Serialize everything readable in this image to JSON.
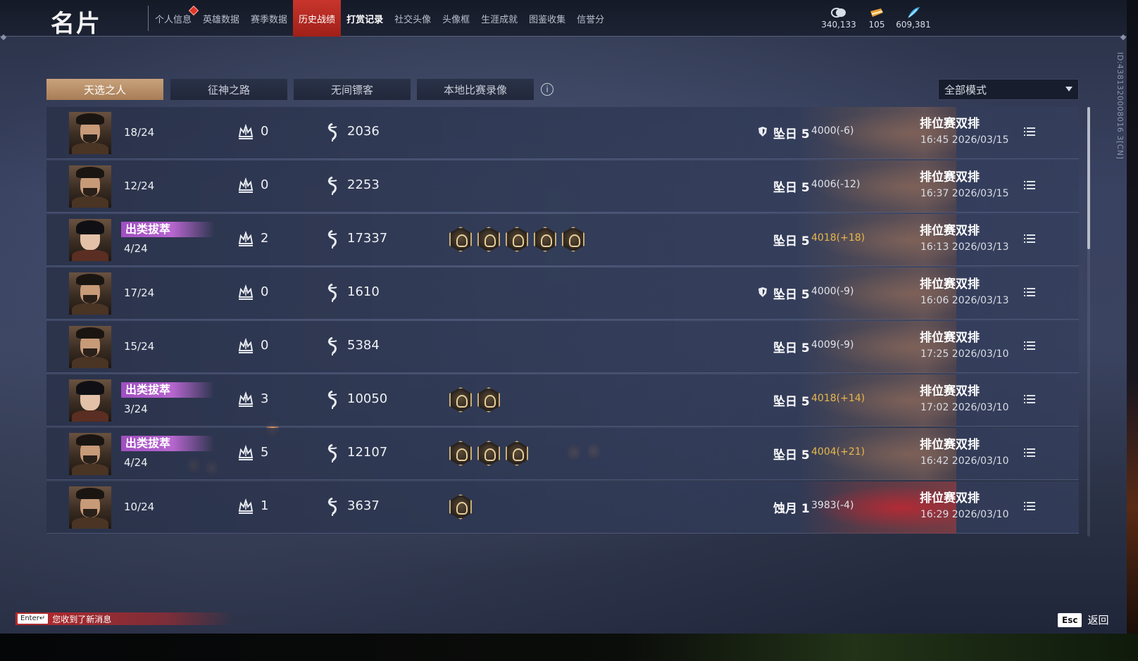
{
  "header": {
    "title": "名片",
    "tabs": [
      {
        "label": "个人信息",
        "dot": true
      },
      {
        "label": "英雄数据"
      },
      {
        "label": "赛季数据"
      },
      {
        "label": "历史战绩",
        "active": true
      },
      {
        "label": "打赏记录",
        "bold": true
      },
      {
        "label": "社交头像"
      },
      {
        "label": "头像框"
      },
      {
        "label": "生涯成就"
      },
      {
        "label": "图鉴收集"
      },
      {
        "label": "信誉分"
      }
    ],
    "currencies": [
      {
        "icon": "coin-stack-icon",
        "value": "340,133"
      },
      {
        "icon": "ticket-icon",
        "value": "105"
      },
      {
        "icon": "feather-icon",
        "value": "609,381"
      }
    ]
  },
  "subtabs": [
    "天选之人",
    "征神之路",
    "无间镖客",
    "本地比赛录像"
  ],
  "mode_select": {
    "value": "全部模式"
  },
  "rows": [
    {
      "avatar": "warrior",
      "badge": "",
      "ratio": "18/24",
      "kills": "0",
      "gold": "2036",
      "medals": [],
      "shield": true,
      "rank": "坠日 5",
      "score": "4000(-6)",
      "gain": false,
      "art": "dragon",
      "mode": "排位赛双排",
      "time": "16:45  2026/03/15"
    },
    {
      "avatar": "warrior",
      "badge": "",
      "ratio": "12/24",
      "kills": "0",
      "gold": "2253",
      "medals": [],
      "shield": false,
      "rank": "坠日 5",
      "score": "4006(-12)",
      "gain": false,
      "art": "dragon",
      "mode": "排位赛双排",
      "time": "16:37  2026/03/15"
    },
    {
      "avatar": "scholar",
      "badge": "出类拔萃",
      "ratio": "4/24",
      "kills": "2",
      "gold": "17337",
      "medals": [
        "medal-1",
        "medal-2",
        "medal-3",
        "medal-4",
        "medal-5"
      ],
      "shield": false,
      "rank": "坠日 5",
      "score": "4018(+18)",
      "gain": true,
      "art": "dragon",
      "mode": "排位赛双排",
      "time": "16:13  2026/03/13"
    },
    {
      "avatar": "warrior",
      "badge": "",
      "ratio": "17/24",
      "kills": "0",
      "gold": "1610",
      "medals": [],
      "shield": true,
      "rank": "坠日 5",
      "score": "4000(-9)",
      "gain": false,
      "art": "dragon",
      "mode": "排位赛双排",
      "time": "16:06  2026/03/13"
    },
    {
      "avatar": "warrior",
      "badge": "",
      "ratio": "15/24",
      "kills": "0",
      "gold": "5384",
      "medals": [],
      "shield": false,
      "rank": "坠日 5",
      "score": "4009(-9)",
      "gain": false,
      "art": "dragon",
      "mode": "排位赛双排",
      "time": "17:25  2026/03/10"
    },
    {
      "avatar": "scholar",
      "badge": "出类拔萃",
      "ratio": "3/24",
      "kills": "3",
      "gold": "10050",
      "medals": [
        "medal-1",
        "medal-2"
      ],
      "shield": false,
      "rank": "坠日 5",
      "score": "4018(+14)",
      "gain": true,
      "art": "dragon",
      "mode": "排位赛双排",
      "time": "17:02  2026/03/10"
    },
    {
      "avatar": "warrior",
      "badge": "出类拔萃",
      "ratio": "4/24",
      "kills": "5",
      "gold": "12107",
      "medals": [
        "medal-1",
        "medal-2",
        "medal-3"
      ],
      "shield": false,
      "rank": "坠日 5",
      "score": "4004(+21)",
      "gain": true,
      "art": "dragon",
      "mode": "排位赛双排",
      "time": "16:42  2026/03/10"
    },
    {
      "avatar": "warrior",
      "badge": "",
      "ratio": "10/24",
      "kills": "1",
      "gold": "3637",
      "medals": [
        "medal-1"
      ],
      "shield": false,
      "rank": "蚀月 1",
      "score": "3983(-4)",
      "gain": false,
      "art": "red-moon",
      "mode": "排位赛双排",
      "time": "16:29  2026/03/10"
    }
  ],
  "side_id": "ID:4381320008016 3[CN]",
  "footer": {
    "enter_key": "Enter↵",
    "notification": "您收到了新消息",
    "esc_key": "Esc",
    "back_label": "返回"
  },
  "colors": {
    "accent": "#c8352c",
    "active_subtab": "#b88c64",
    "badge": "#b766cf",
    "gain": "#e8b84a"
  }
}
